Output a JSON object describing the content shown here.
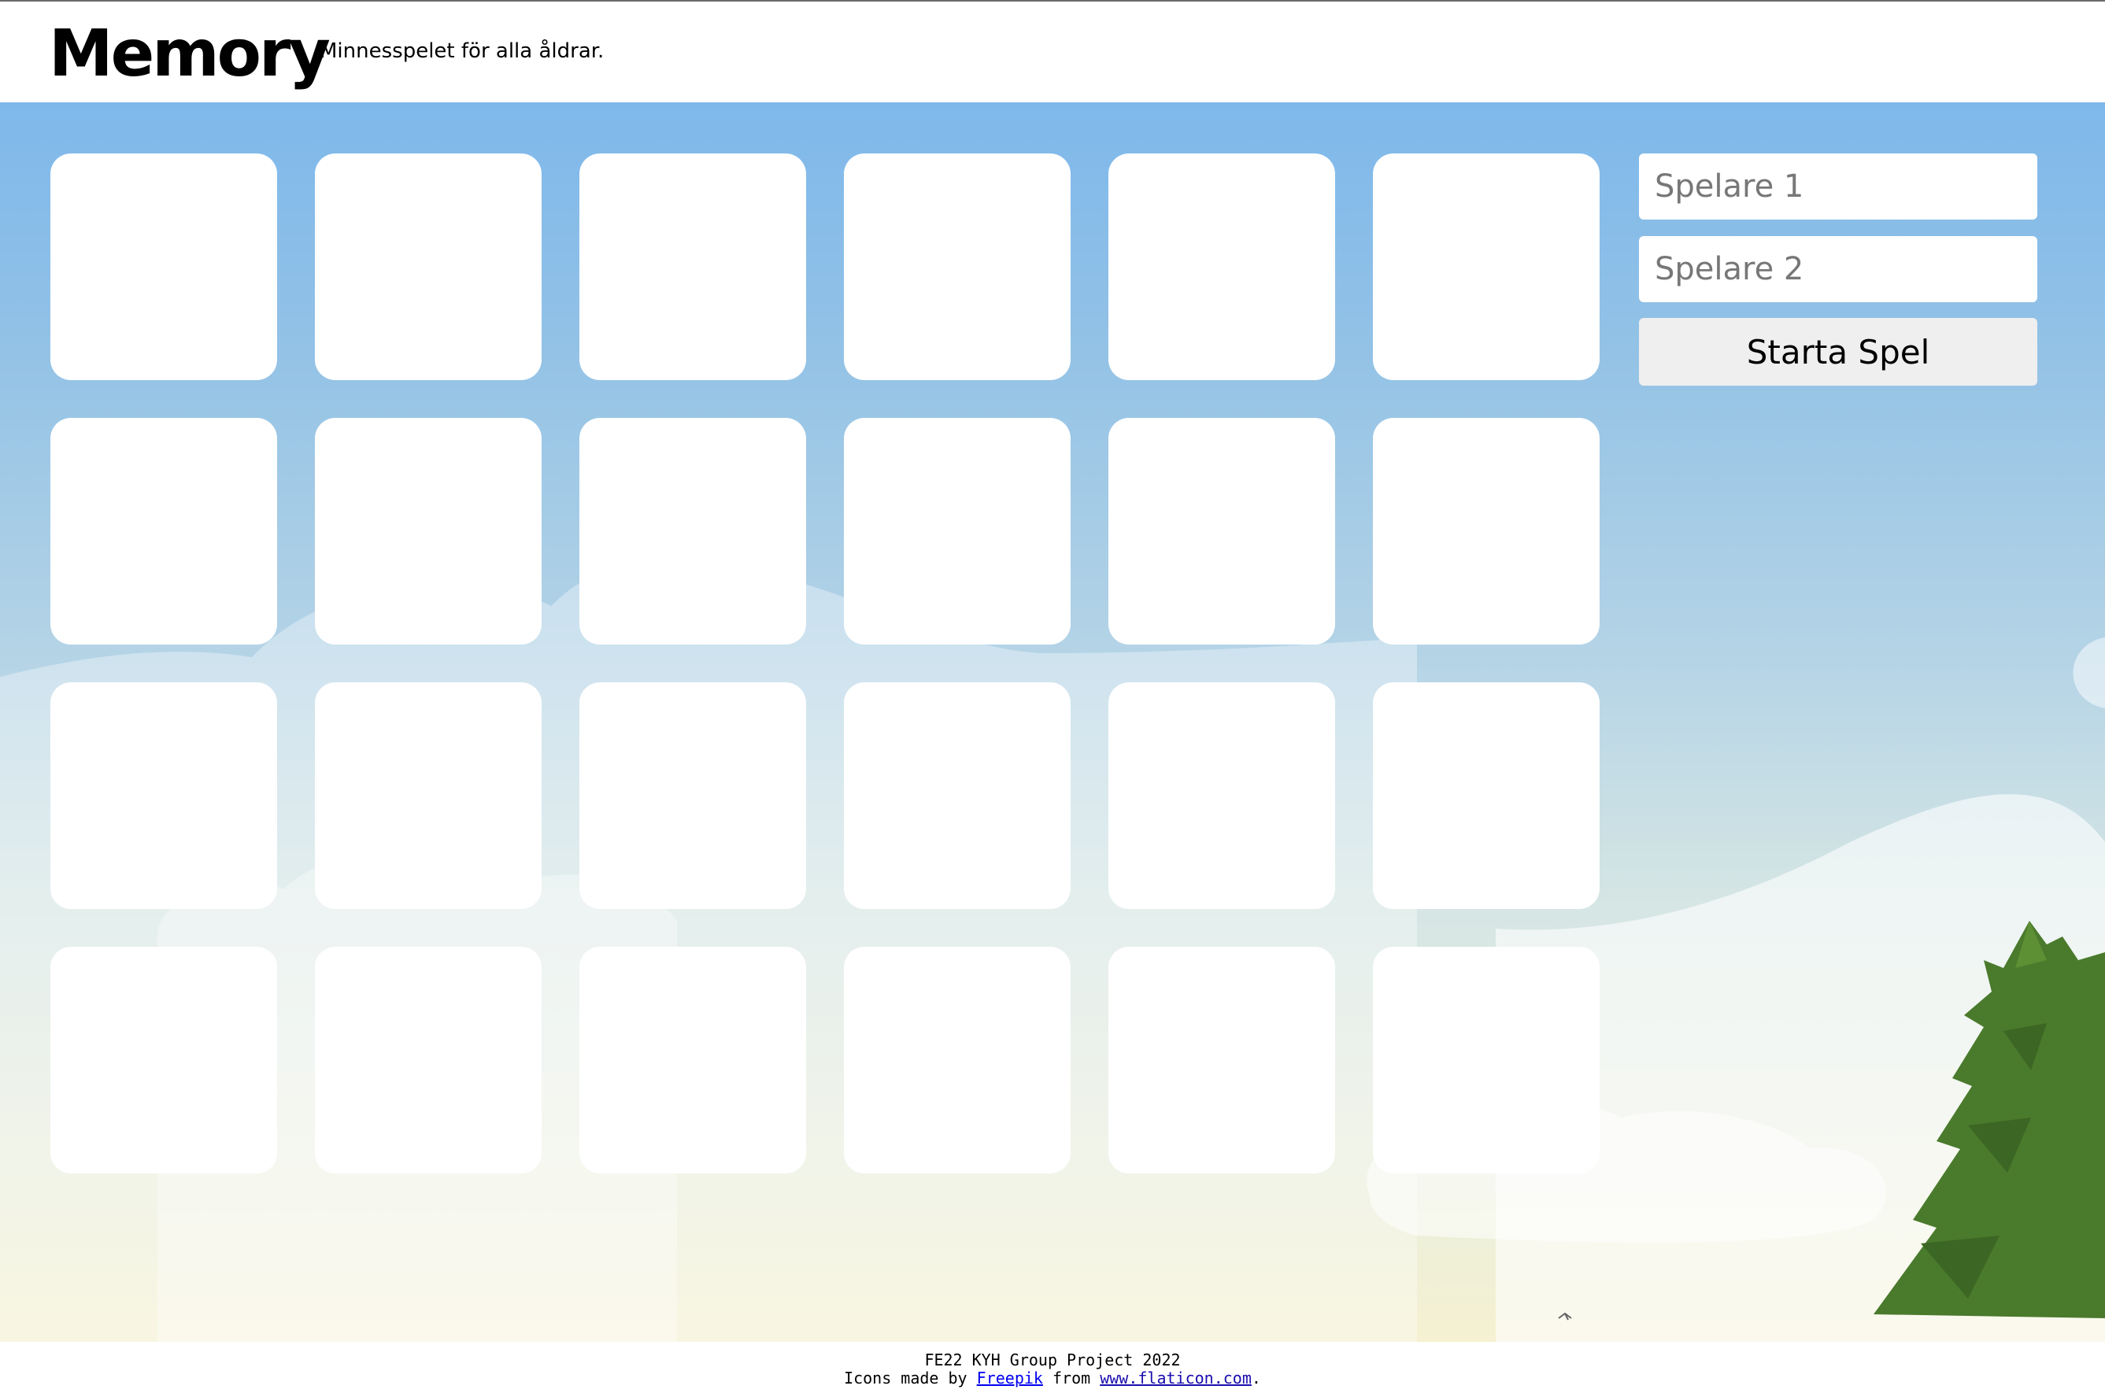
{
  "header": {
    "logo_text": "Memory",
    "tagline": "Minnesspelet för alla åldrar."
  },
  "board": {
    "rows": 4,
    "columns": 6,
    "cards": [
      {
        "state": "face-down"
      },
      {
        "state": "face-down"
      },
      {
        "state": "face-down"
      },
      {
        "state": "face-down"
      },
      {
        "state": "face-down"
      },
      {
        "state": "face-down"
      },
      {
        "state": "face-down"
      },
      {
        "state": "face-down"
      },
      {
        "state": "face-down"
      },
      {
        "state": "face-down"
      },
      {
        "state": "face-down"
      },
      {
        "state": "face-down"
      },
      {
        "state": "face-down"
      },
      {
        "state": "face-down"
      },
      {
        "state": "face-down"
      },
      {
        "state": "face-down"
      },
      {
        "state": "face-down"
      },
      {
        "state": "face-down"
      },
      {
        "state": "face-down"
      },
      {
        "state": "face-down"
      },
      {
        "state": "face-down"
      },
      {
        "state": "face-down"
      },
      {
        "state": "face-down"
      },
      {
        "state": "face-down"
      }
    ]
  },
  "panel": {
    "player1": {
      "value": "",
      "placeholder": "Spelare 1"
    },
    "player2": {
      "value": "",
      "placeholder": "Spelare 2"
    },
    "start_label": "Starta Spel"
  },
  "footer": {
    "line1": "FE22 KYH Group Project 2022",
    "credit_prefix": "Icons made by",
    "author_link": "Freepik",
    "from_word": "from",
    "site_link": "www.flaticon.com",
    "period": "."
  },
  "colors": {
    "sky_top": "#7eb8eb",
    "sky_bottom": "#f5f1d2",
    "card": "#ffffff",
    "tree": "#4a7a2c",
    "button": "#efefef"
  }
}
